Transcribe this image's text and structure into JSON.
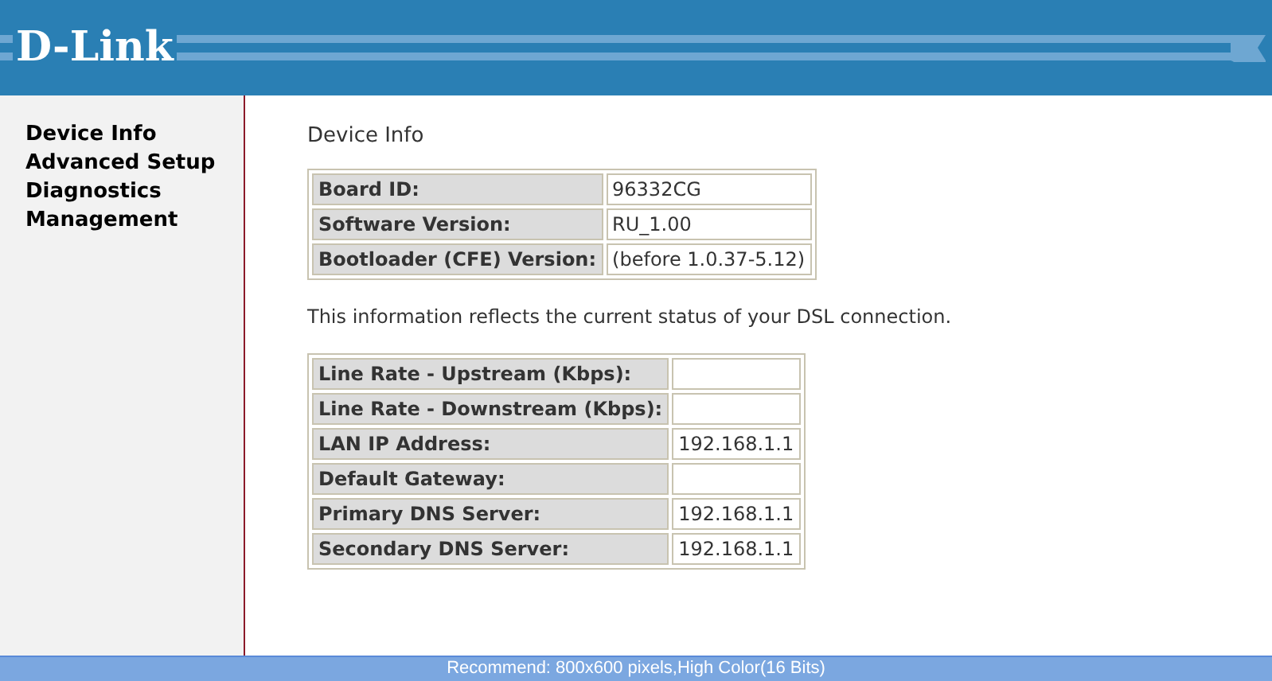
{
  "header": {
    "logo": "D-Link"
  },
  "sidebar": {
    "items": [
      {
        "label": "Device Info"
      },
      {
        "label": "Advanced Setup"
      },
      {
        "label": "Diagnostics"
      },
      {
        "label": "Management"
      }
    ]
  },
  "page": {
    "title": "Device Info",
    "info_table": [
      {
        "label": "Board ID:",
        "value": "96332CG"
      },
      {
        "label": "Software Version:",
        "value": "RU_1.00"
      },
      {
        "label": "Bootloader (CFE) Version:",
        "value": "(before 1.0.37-5.12)"
      }
    ],
    "note": "This information reflects the current status of your DSL connection.",
    "status_table": [
      {
        "label": "Line Rate - Upstream (Kbps):"
      },
      {
        "label": "Line Rate - Downstream (Kbps):"
      },
      {
        "label": "LAN IP Address:",
        "value": "192.168.1.1"
      },
      {
        "label": "Default Gateway:"
      },
      {
        "label": "Primary DNS Server:",
        "value": "192.168.1.1"
      },
      {
        "label": "Secondary DNS Server:",
        "value": "192.168.1.1"
      }
    ]
  },
  "status_bar": "Recommend: 800x600 pixels,High Color(16 Bits)"
}
